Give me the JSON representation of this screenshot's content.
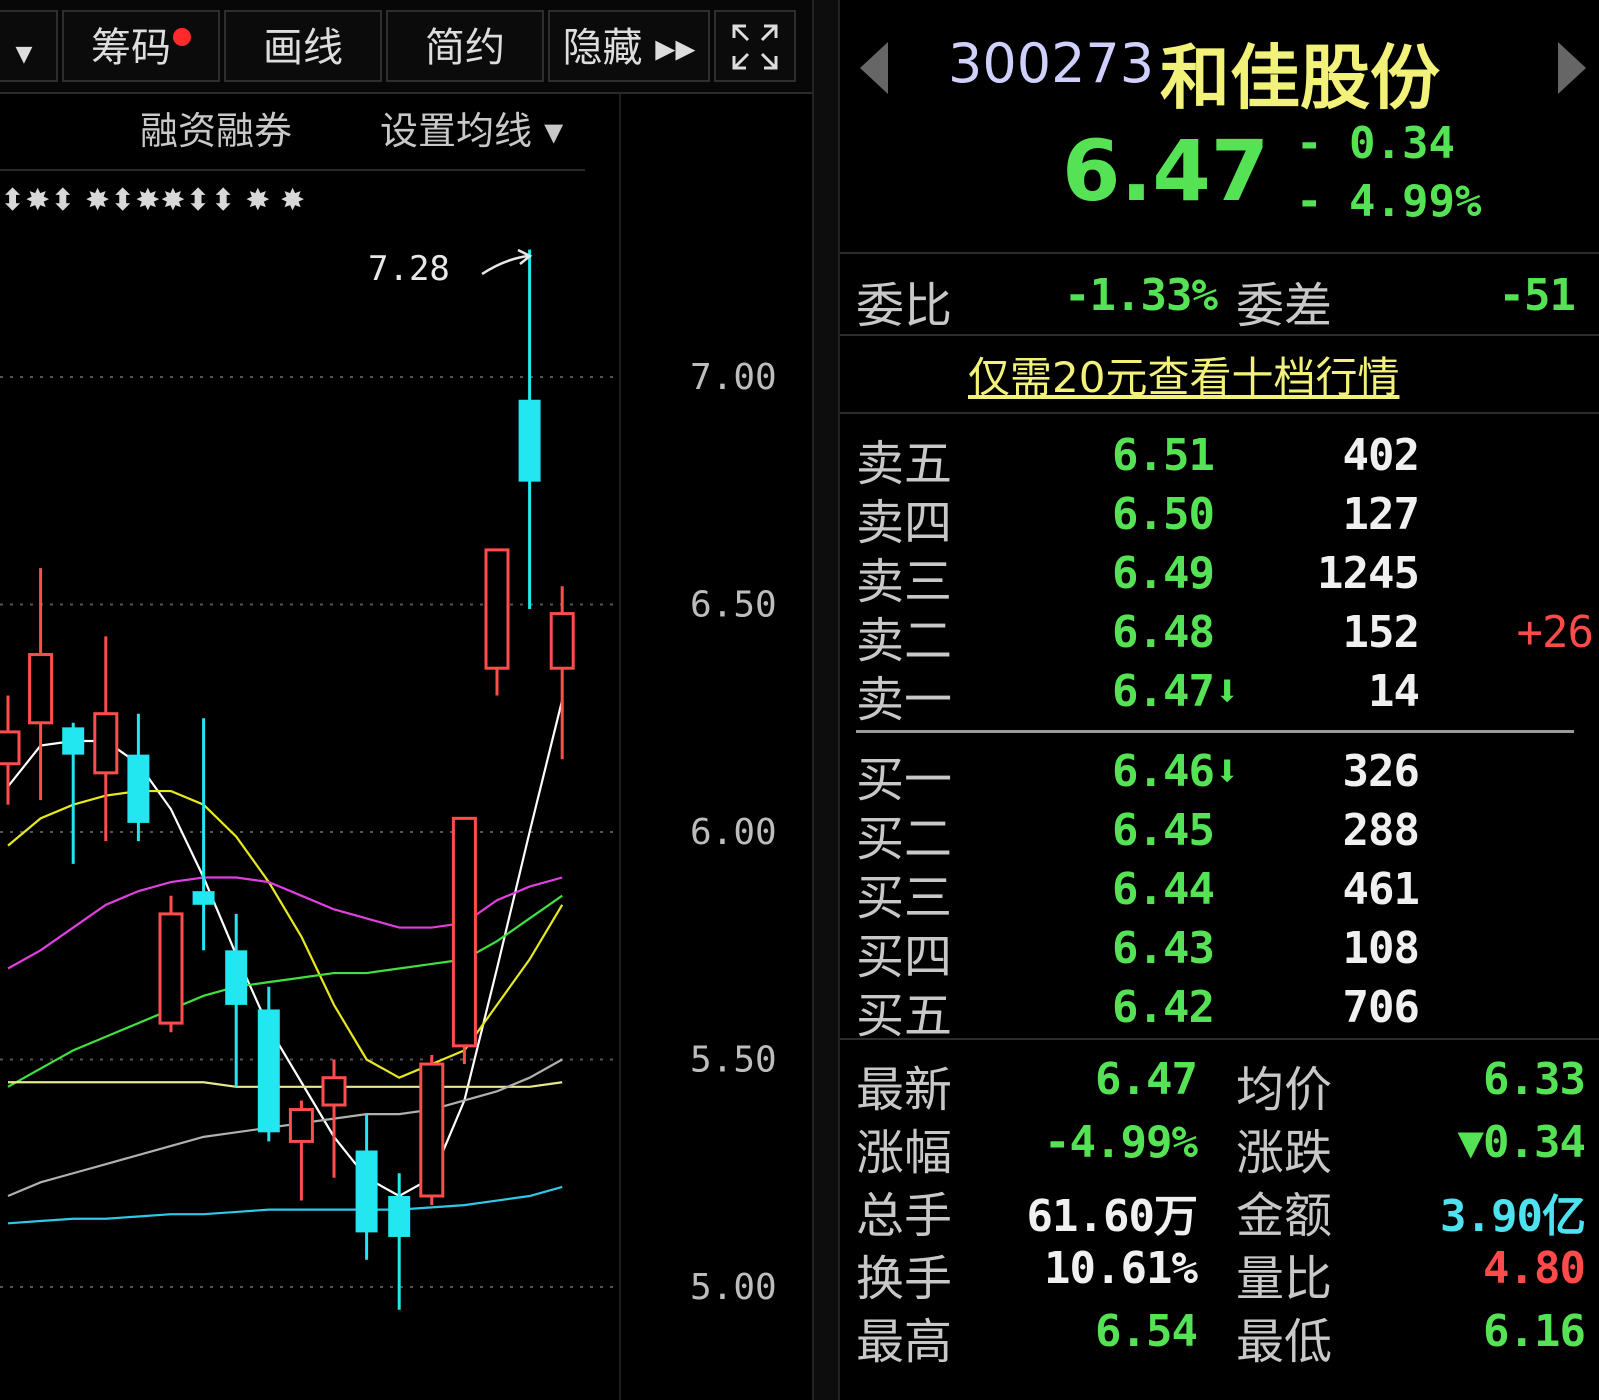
{
  "toolbar": {
    "items": [
      {
        "label": "筹码",
        "has_dot": true
      },
      {
        "label": "画线"
      },
      {
        "label": "简约"
      },
      {
        "label": "隐藏 ▸▸"
      }
    ],
    "fullscreen_icon": "expand-icon",
    "dropdown_icon": "chevron-down-icon"
  },
  "chart": {
    "margin_label": "融资融券",
    "ma_setting_label": "设置均线 ▾",
    "signal_marks": "⬍✸⬍  ✸⬍✸✸⬍⬍   ✸      ✸",
    "high_annotation": "7.28",
    "y_ticks": [
      "7.00",
      "6.50",
      "6.00",
      "5.50",
      "5.00"
    ]
  },
  "chart_data": {
    "type": "candlestick",
    "y_range": [
      4.9,
      7.35
    ],
    "y_ticks": [
      7.0,
      6.5,
      6.0,
      5.5,
      5.0
    ],
    "high_label": 7.28,
    "candles": [
      {
        "o": 6.15,
        "c": 6.22,
        "h": 6.3,
        "l": 6.06,
        "color": "red"
      },
      {
        "o": 6.24,
        "c": 6.39,
        "h": 6.58,
        "l": 6.07,
        "color": "red"
      },
      {
        "o": 6.23,
        "c": 6.17,
        "h": 6.24,
        "l": 5.93,
        "color": "cyan"
      },
      {
        "o": 6.13,
        "c": 6.26,
        "h": 6.43,
        "l": 5.98,
        "color": "red"
      },
      {
        "o": 6.17,
        "c": 6.02,
        "h": 6.26,
        "l": 5.98,
        "color": "cyan"
      },
      {
        "o": 5.58,
        "c": 5.82,
        "h": 5.86,
        "l": 5.56,
        "color": "red"
      },
      {
        "o": 5.87,
        "c": 5.84,
        "h": 6.25,
        "l": 5.74,
        "color": "cyan"
      },
      {
        "o": 5.74,
        "c": 5.62,
        "h": 5.82,
        "l": 5.44,
        "color": "cyan"
      },
      {
        "o": 5.61,
        "c": 5.34,
        "h": 5.66,
        "l": 5.32,
        "color": "cyan"
      },
      {
        "o": 5.32,
        "c": 5.39,
        "h": 5.41,
        "l": 5.19,
        "color": "red"
      },
      {
        "o": 5.4,
        "c": 5.46,
        "h": 5.5,
        "l": 5.24,
        "color": "red"
      },
      {
        "o": 5.3,
        "c": 5.12,
        "h": 5.38,
        "l": 5.06,
        "color": "cyan"
      },
      {
        "o": 5.2,
        "c": 5.11,
        "h": 5.25,
        "l": 4.95,
        "color": "cyan"
      },
      {
        "o": 5.2,
        "c": 5.49,
        "h": 5.51,
        "l": 5.18,
        "color": "red"
      },
      {
        "o": 5.53,
        "c": 6.03,
        "h": 6.03,
        "l": 5.49,
        "color": "red"
      },
      {
        "o": 6.36,
        "c": 6.62,
        "h": 6.62,
        "l": 6.3,
        "color": "red"
      },
      {
        "o": 6.95,
        "c": 6.77,
        "h": 7.28,
        "l": 6.49,
        "color": "cyan"
      },
      {
        "o": 6.36,
        "c": 6.48,
        "h": 6.54,
        "l": 6.16,
        "color": "red"
      }
    ],
    "ma_lines": [
      {
        "color": "#ffffff",
        "values": [
          6.1,
          6.19,
          6.2,
          6.2,
          6.15,
          6.05,
          5.9,
          5.73,
          5.57,
          5.45,
          5.33,
          5.24,
          5.2,
          5.24,
          5.41,
          5.7,
          6.0,
          6.29
        ]
      },
      {
        "color": "#e8e820",
        "values": [
          5.97,
          6.03,
          6.06,
          6.08,
          6.09,
          6.09,
          6.06,
          5.99,
          5.89,
          5.77,
          5.62,
          5.5,
          5.46,
          5.49,
          5.52,
          5.62,
          5.72,
          5.84
        ]
      },
      {
        "color": "#e040e0",
        "values": [
          5.7,
          5.74,
          5.79,
          5.84,
          5.87,
          5.89,
          5.9,
          5.9,
          5.89,
          5.86,
          5.83,
          5.81,
          5.79,
          5.79,
          5.8,
          5.85,
          5.88,
          5.9
        ]
      },
      {
        "color": "#40e040",
        "values": [
          5.44,
          5.48,
          5.52,
          5.55,
          5.58,
          5.61,
          5.64,
          5.66,
          5.67,
          5.68,
          5.69,
          5.69,
          5.7,
          5.71,
          5.72,
          5.76,
          5.81,
          5.86
        ]
      },
      {
        "color": "#e8e890",
        "values": [
          5.45,
          5.45,
          5.45,
          5.45,
          5.45,
          5.45,
          5.45,
          5.44,
          5.44,
          5.44,
          5.44,
          5.44,
          5.44,
          5.44,
          5.44,
          5.44,
          5.44,
          5.45
        ]
      },
      {
        "color": "#b0b0b0",
        "values": [
          5.2,
          5.23,
          5.25,
          5.27,
          5.29,
          5.31,
          5.33,
          5.34,
          5.35,
          5.36,
          5.37,
          5.38,
          5.38,
          5.39,
          5.41,
          5.43,
          5.46,
          5.5
        ]
      },
      {
        "color": "#30c8e8",
        "values": [
          5.14,
          5.145,
          5.15,
          5.15,
          5.155,
          5.16,
          5.16,
          5.165,
          5.17,
          5.17,
          5.17,
          5.17,
          5.17,
          5.175,
          5.18,
          5.19,
          5.2,
          5.22
        ]
      }
    ]
  },
  "quote": {
    "code": "300273",
    "name": "和佳股份",
    "price": "6.47",
    "change": "- 0.34",
    "change_pct": "- 4.99%",
    "weibi_label": "委比",
    "weibi_value": "-1.33%",
    "weicha_label": "委差",
    "weicha_value": "-51",
    "promo_link": "仅需20元查看十档行情",
    "asks": [
      {
        "label": "卖五",
        "price": "6.51",
        "vol": "402",
        "chg": ""
      },
      {
        "label": "卖四",
        "price": "6.50",
        "vol": "127",
        "chg": ""
      },
      {
        "label": "卖三",
        "price": "6.49",
        "vol": "1245",
        "chg": ""
      },
      {
        "label": "卖二",
        "price": "6.48",
        "vol": "152",
        "chg": "+26"
      },
      {
        "label": "卖一",
        "price": "6.47⬇",
        "vol": "14",
        "chg": ""
      }
    ],
    "bids": [
      {
        "label": "买一",
        "price": "6.46⬇",
        "vol": "326",
        "chg": ""
      },
      {
        "label": "买二",
        "price": "6.45",
        "vol": "288",
        "chg": ""
      },
      {
        "label": "买三",
        "price": "6.44",
        "vol": "461",
        "chg": ""
      },
      {
        "label": "买四",
        "price": "6.43",
        "vol": "108",
        "chg": ""
      },
      {
        "label": "买五",
        "price": "6.42",
        "vol": "706",
        "chg": ""
      }
    ],
    "stats": [
      {
        "l1": "最新",
        "v1": "6.47",
        "c1": "green",
        "l2": "均价",
        "v2": "6.33",
        "c2": "green"
      },
      {
        "l1": "涨幅",
        "v1": "-4.99%",
        "c1": "green",
        "l2": "涨跌",
        "v2": "▼0.34",
        "c2": "green"
      },
      {
        "l1": "总手",
        "v1": "61.60万",
        "c1": "white",
        "l2": "金额",
        "v2": "3.90亿",
        "c2": "cyan"
      },
      {
        "l1": "换手",
        "v1": "10.61%",
        "c1": "white",
        "l2": "量比",
        "v2": "4.80",
        "c2": "red"
      },
      {
        "l1": "最高",
        "v1": "6.54",
        "c1": "green",
        "l2": "最低",
        "v2": "6.16",
        "c2": "green"
      }
    ]
  },
  "colors": {
    "up": "#ff4d4d",
    "down": "#22e6f0",
    "green_text": "#55e355",
    "yellow_title": "#f2f27a"
  }
}
